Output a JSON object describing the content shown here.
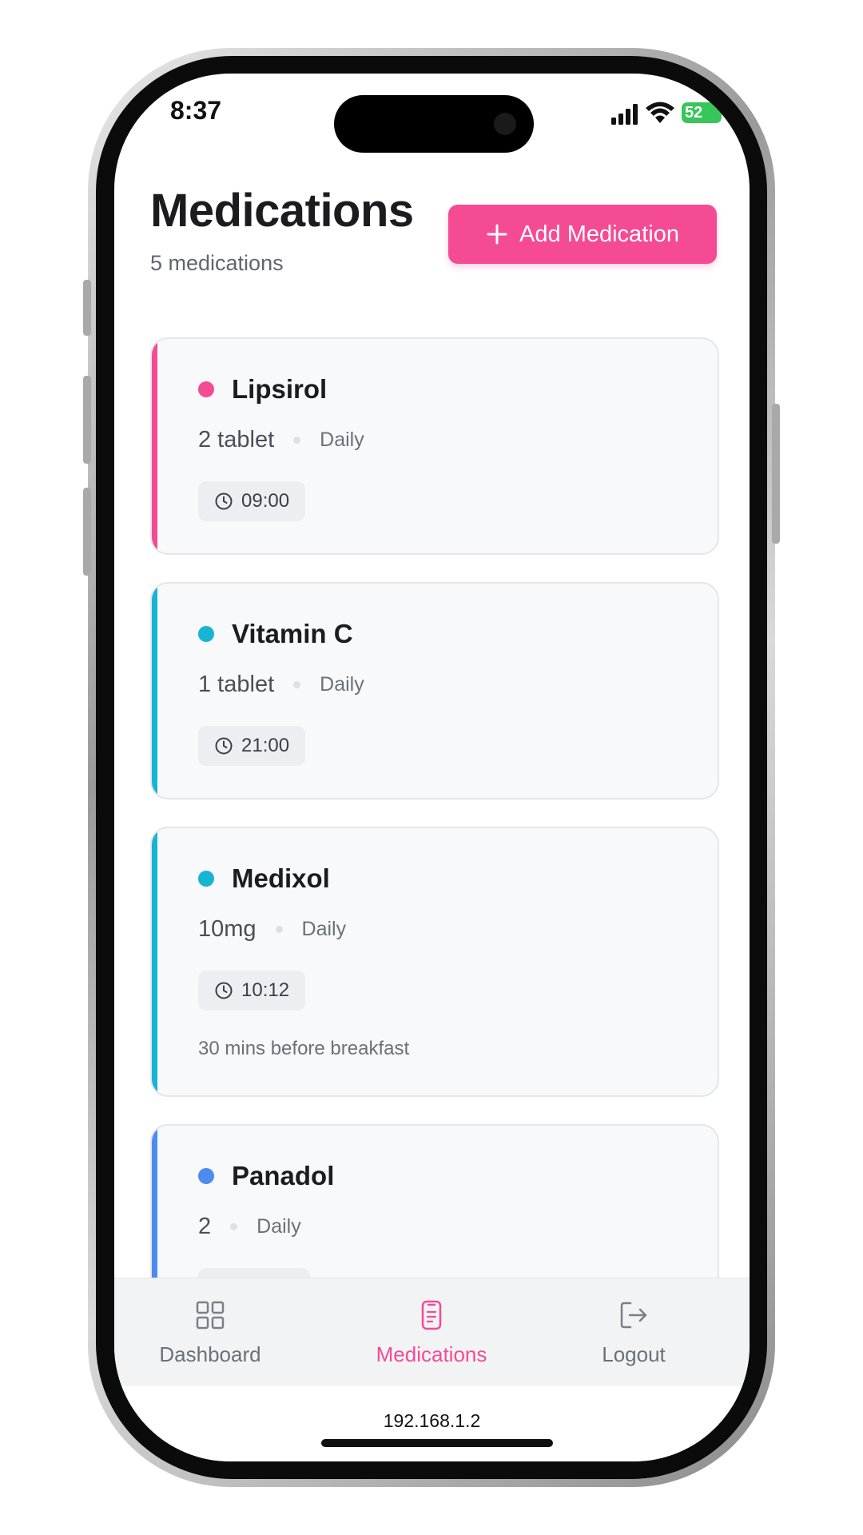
{
  "status_bar": {
    "time": "8:37",
    "battery": "52"
  },
  "header": {
    "title": "Medications",
    "subtitle": "5 medications",
    "add_button_label": "Add Medication"
  },
  "colors": {
    "accent_pink": "#f54b94",
    "cyan": "#18b4d4",
    "blue": "#4c8bf0"
  },
  "medications": [
    {
      "name": "Lipsirol",
      "dose": "2 tablet",
      "frequency": "Daily",
      "time": "09:00",
      "note": "",
      "color": "#f54b94"
    },
    {
      "name": "Vitamin C",
      "dose": "1 tablet",
      "frequency": "Daily",
      "time": "21:00",
      "note": "",
      "color": "#18b4d4"
    },
    {
      "name": "Medixol",
      "dose": "10mg",
      "frequency": "Daily",
      "time": "10:12",
      "note": "30 mins before breakfast",
      "color": "#18b4d4"
    },
    {
      "name": "Panadol",
      "dose": "2",
      "frequency": "Daily",
      "time": "",
      "note": "",
      "color": "#4c8bf0"
    }
  ],
  "nav": {
    "items": [
      {
        "label": "Dashboard",
        "icon": "grid-icon",
        "active": false
      },
      {
        "label": "Medications",
        "icon": "clipboard-icon",
        "active": true
      },
      {
        "label": "Logout",
        "icon": "logout-icon",
        "active": false
      }
    ]
  },
  "browser": {
    "url": "192.168.1.2"
  }
}
